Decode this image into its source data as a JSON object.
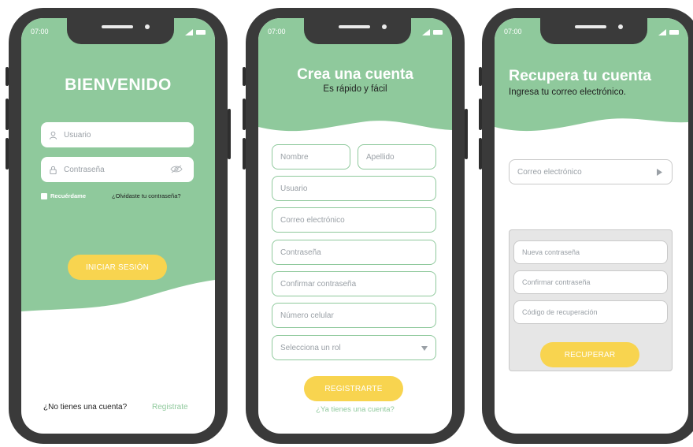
{
  "status": {
    "time": "07:00"
  },
  "login": {
    "title": "BIENVENIDO",
    "user_placeholder": "Usuario",
    "password_placeholder": "Contraseña",
    "remember_label": "Recuérdame",
    "forgot_label": "¿Olvidaste tu contraseña?",
    "submit_label": "INICIAR SESIÓN",
    "no_account_label": "¿No tienes una cuenta?",
    "register_link": "Registrate"
  },
  "register": {
    "title": "Crea una cuenta",
    "subtitle": "Es rápido y fácil",
    "first_name": "Nombre",
    "last_name": "Apellido",
    "username": "Usuario",
    "email": "Correo electrónico",
    "password": "Contraseña",
    "confirm_password": "Confirmar contraseña",
    "phone": "Número celular",
    "role": "Selecciona un rol",
    "submit_label": "REGISTRARTE",
    "have_account_link": "¿Ya tienes una cuenta?"
  },
  "recover": {
    "title": "Recupera tu cuenta",
    "subtitle": "Ingresa tu correo electrónico.",
    "email": "Correo electrónico",
    "new_password": "Nueva contraseña",
    "confirm_password": "Confirmar contraseña",
    "code": "Código de recuperación",
    "submit_label": "RECUPERAR"
  },
  "colors": {
    "green": "#8fc99c",
    "yellow": "#f8d44f"
  }
}
